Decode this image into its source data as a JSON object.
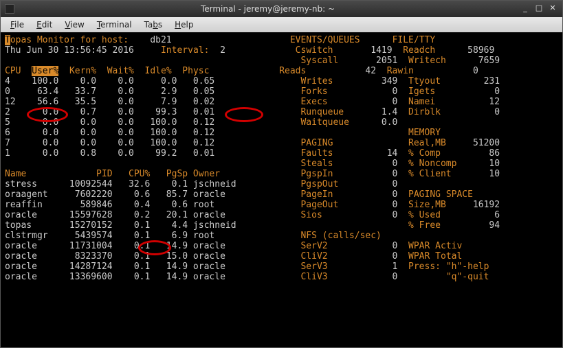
{
  "window": {
    "title": "Terminal - jeremy@jeremy-nb: ~",
    "min": "_",
    "max": "□",
    "close": "✕"
  },
  "menu": {
    "file": "File",
    "edit": "Edit",
    "view": "View",
    "terminal": "Terminal",
    "tabs": "Tabs",
    "help": "Help"
  },
  "hdr": {
    "topas_label": "opas Monitor for host:",
    "topas_T": "T",
    "host": "db21",
    "events": "EVENTS/QUEUES",
    "filetty": "FILE/TTY",
    "date": "Thu Jun 30 13:56:45 2016",
    "interval_lbl": "Interval:",
    "interval_v": "2",
    "cswitch_l": "Cswitch",
    "cswitch_v": "1419",
    "readch_l": "Readch",
    "readch_v": "58969",
    "syscall_l": "Syscall",
    "syscall_v": "2051",
    "writech_l": "Writech",
    "writech_v": "7659"
  },
  "cpu_hdr": {
    "c0": "CPU",
    "c1": "User%",
    "c2": "Kern%",
    "c3": "Wait%",
    "c4": "Idle%",
    "c5": "Physc"
  },
  "cpu": [
    {
      "c0": "4",
      "c1": "100.0",
      "c2": "0.0",
      "c3": "0.0",
      "c4": "0.0",
      "c5": "0.65"
    },
    {
      "c0": "0",
      "c1": "63.4",
      "c2": "33.7",
      "c3": "0.0",
      "c4": "2.9",
      "c5": "0.05"
    },
    {
      "c0": "12",
      "c1": "56.6",
      "c2": "35.5",
      "c3": "0.0",
      "c4": "7.9",
      "c5": "0.02"
    },
    {
      "c0": "2",
      "c1": "0.0",
      "c2": "0.7",
      "c3": "0.0",
      "c4": "99.3",
      "c5": "0.01"
    },
    {
      "c0": "5",
      "c1": "0.0",
      "c2": "0.0",
      "c3": "0.0",
      "c4": "100.0",
      "c5": "0.12"
    },
    {
      "c0": "6",
      "c1": "0.0",
      "c2": "0.0",
      "c3": "0.0",
      "c4": "100.0",
      "c5": "0.12"
    },
    {
      "c0": "7",
      "c1": "0.0",
      "c2": "0.0",
      "c3": "0.0",
      "c4": "100.0",
      "c5": "0.12"
    },
    {
      "c0": "1",
      "c1": "0.0",
      "c2": "0.8",
      "c3": "0.0",
      "c4": "99.2",
      "c5": "0.01"
    }
  ],
  "right_rows": [
    {
      "l1": "Reads",
      "v1": "42",
      "l2": "Rawin",
      "v2": "0"
    },
    {
      "l1": "Writes",
      "v1": "349",
      "l2": "Ttyout",
      "v2": "231"
    },
    {
      "l1": "Forks",
      "v1": "0",
      "l2": "Igets",
      "v2": "0"
    },
    {
      "l1": "Execs",
      "v1": "0",
      "l2": "Namei",
      "v2": "12"
    },
    {
      "l1": "Runqueue",
      "v1": "1.4",
      "l2": "Dirblk",
      "v2": "0"
    },
    {
      "l1": "Waitqueue",
      "v1": "0.0",
      "l2": "",
      "v2": ""
    },
    {
      "l1": "",
      "v1": "",
      "l2": "MEMORY",
      "v2": ""
    },
    {
      "l1": "PAGING",
      "v1": "",
      "l2": "Real,MB",
      "v2": "51200"
    },
    {
      "l1": "Faults",
      "v1": "14",
      "l2": "% Comp",
      "v2": "86"
    },
    {
      "l1": "Steals",
      "v1": "0",
      "l2": "% Noncomp",
      "v2": "10"
    }
  ],
  "proc_hdr": {
    "c0": "Name",
    "c1": "PID",
    "c2": "CPU%",
    "c3": "PgSp",
    "c4": "Owner"
  },
  "proc": [
    {
      "c0": "stress",
      "c1": "10092544",
      "c2": "32.6",
      "c3": "0.1",
      "c4": "jschneid"
    },
    {
      "c0": "oraagent",
      "c1": "7602220",
      "c2": "0.6",
      "c3": "85.7",
      "c4": "oracle"
    },
    {
      "c0": "reaffin",
      "c1": "589846",
      "c2": "0.4",
      "c3": "0.6",
      "c4": "root"
    },
    {
      "c0": "oracle",
      "c1": "15597628",
      "c2": "0.2",
      "c3": "20.1",
      "c4": "oracle"
    },
    {
      "c0": "topas",
      "c1": "15270152",
      "c2": "0.1",
      "c3": "4.4",
      "c4": "jschneid"
    },
    {
      "c0": "clstrmgr",
      "c1": "5439574",
      "c2": "0.1",
      "c3": "6.9",
      "c4": "root"
    },
    {
      "c0": "oracle",
      "c1": "11731004",
      "c2": "0.1",
      "c3": "14.9",
      "c4": "oracle"
    },
    {
      "c0": "oracle",
      "c1": "8323370",
      "c2": "0.1",
      "c3": "15.0",
      "c4": "oracle"
    },
    {
      "c0": "oracle",
      "c1": "14287124",
      "c2": "0.1",
      "c3": "14.9",
      "c4": "oracle"
    },
    {
      "c0": "oracle",
      "c1": "13369600",
      "c2": "0.1",
      "c3": "14.9",
      "c4": "oracle"
    }
  ],
  "right2": [
    {
      "l1": "PgspIn",
      "v1": "0",
      "l2": "% Client",
      "v2": "10"
    },
    {
      "l1": "PgspOut",
      "v1": "0",
      "l2": "",
      "v2": ""
    },
    {
      "l1": "PageIn",
      "v1": "0",
      "l2": "PAGING SPACE",
      "v2": ""
    },
    {
      "l1": "PageOut",
      "v1": "0",
      "l2": "Size,MB",
      "v2": "16192"
    },
    {
      "l1": "Sios",
      "v1": "0",
      "l2": "% Used",
      "v2": "6"
    },
    {
      "l1": "",
      "v1": "",
      "l2": "% Free",
      "v2": "94"
    },
    {
      "l1": "NFS (calls/sec)",
      "v1": "",
      "l2": "",
      "v2": ""
    },
    {
      "l1": "SerV2",
      "v1": "0",
      "l2": "WPAR Activ",
      "v2": ""
    },
    {
      "l1": "CliV2",
      "v1": "0",
      "l2": "WPAR Total",
      "v2": ""
    },
    {
      "l1": "SerV3",
      "v1": "1",
      "l2": "Press: \"h\"-help",
      "v2": ""
    },
    {
      "l1": "CliV3",
      "v1": "0",
      "l2": "       \"q\"-quit",
      "v2": ""
    }
  ]
}
